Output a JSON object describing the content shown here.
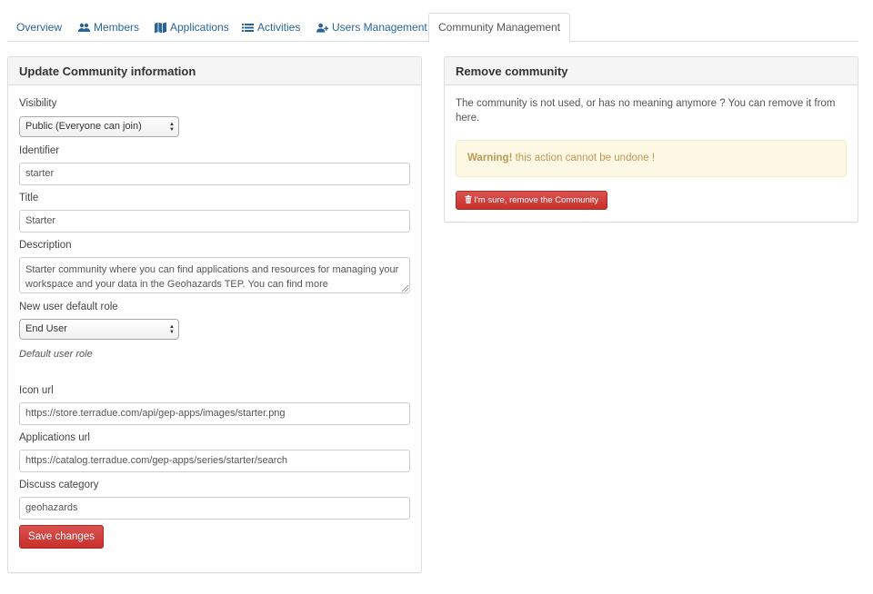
{
  "tabs": [
    {
      "label": "Overview",
      "icon": ""
    },
    {
      "label": "Members",
      "icon": "users-icon"
    },
    {
      "label": "Applications",
      "icon": "map-icon"
    },
    {
      "label": "Activities",
      "icon": "list-icon"
    },
    {
      "label": "Users Management",
      "icon": "user-plus-icon"
    },
    {
      "label": "Community Management",
      "icon": ""
    }
  ],
  "active_tab": "Community Management",
  "update_panel": {
    "title": "Update Community information",
    "visibility": {
      "label": "Visibility",
      "value": "Public (Everyone can join)"
    },
    "identifier": {
      "label": "Identifier",
      "value": "starter"
    },
    "title_field": {
      "label": "Title",
      "value": "Starter"
    },
    "description": {
      "label": "Description",
      "value": "Starter community where you can find applications and resources for managing your workspace and your data in the Geohazards TEP. You can find more"
    },
    "default_role": {
      "label": "New user default role",
      "value": "End User",
      "help": "Default user role"
    },
    "icon_url": {
      "label": "Icon url",
      "value": "https://store.terradue.com/api/gep-apps/images/starter.png"
    },
    "applications_url": {
      "label": "Applications url",
      "value": "https://catalog.terradue.com/gep-apps/series/starter/search"
    },
    "discuss_category": {
      "label": "Discuss category",
      "value": "geohazards"
    },
    "save_label": "Save changes"
  },
  "remove_panel": {
    "title": "Remove community",
    "description": "The community is not used, or has no meaning anymore ? You can remove it from here.",
    "warning_strong": "Warning!",
    "warning_text": " this action cannot be undone !",
    "remove_label": "I'm sure, remove the Community"
  },
  "colors": {
    "link": "#2a6496",
    "danger": "#d9534f",
    "warning_bg": "#fcf8e3",
    "warning_text": "#c09853"
  }
}
